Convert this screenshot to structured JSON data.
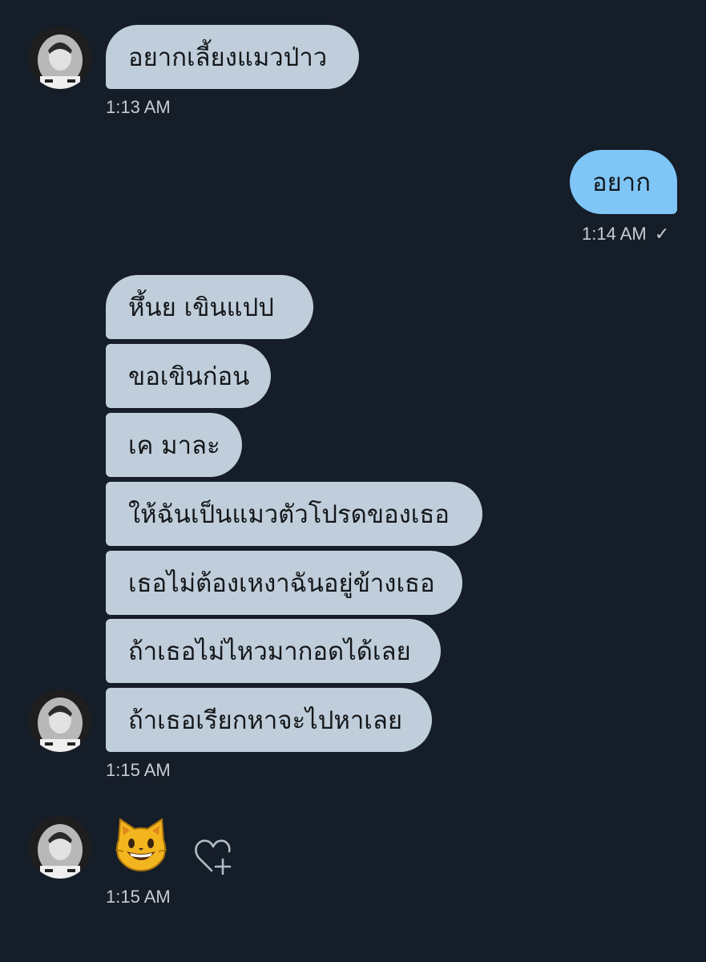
{
  "conversation": {
    "incoming_group_1": {
      "messages": [
        "อยากเลี้ยงแมวป่าว"
      ],
      "time": "1:13 AM"
    },
    "outgoing_group_1": {
      "messages": [
        "อยาก"
      ],
      "time": "1:14 AM",
      "status_glyph": "✓"
    },
    "incoming_group_2": {
      "messages": [
        "หึ้นย เขินแปป",
        "ขอเขินก่อน",
        "เค มาละ",
        "ให้ฉันเป็นแมวตัวโปรดของเธอ",
        "เธอไม่ต้องเหงาฉันอยู่ข้างเธอ",
        "ถ้าเธอไม่ไหวมากอดได้เลย",
        "ถ้าเธอเรียกหาจะไปหาเลย"
      ],
      "time": "1:15 AM"
    },
    "incoming_group_3": {
      "emoji": "grinning-cat-emoji",
      "time": "1:15 AM"
    }
  },
  "colors": {
    "background": "#151d28",
    "incoming_bubble": "#c0cedb",
    "outgoing_bubble": "#7fc6f7",
    "timestamp": "#c6ccd3"
  },
  "icons": [
    "avatar",
    "grinning-cat-emoji",
    "add-reaction-heart-icon",
    "sent-check-icon"
  ]
}
